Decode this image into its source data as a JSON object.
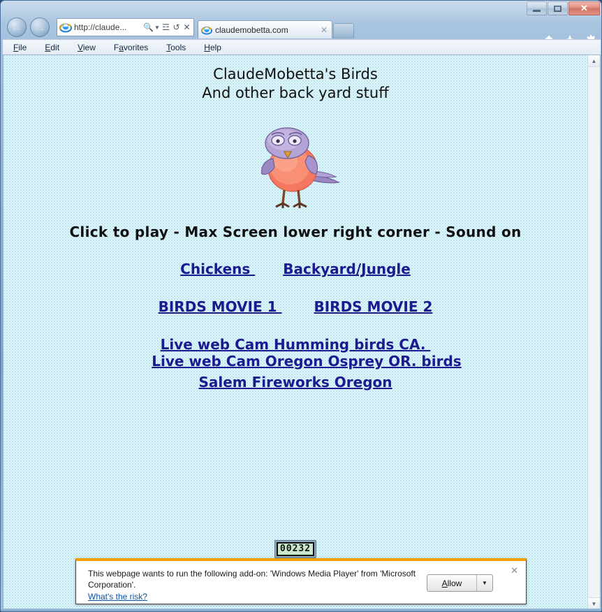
{
  "browser": {
    "window_controls": {
      "minimize": "minimize-icon",
      "maximize": "maximize-icon",
      "close": "✕"
    },
    "nav": {
      "back": "←",
      "forward": "→"
    },
    "address": {
      "value": "http://claude...",
      "search_icon": "🔍",
      "dropdown_caret": "▼",
      "compat_icon": "☲",
      "refresh_icon": "↺",
      "stop_icon": "✕"
    },
    "tab": {
      "title": "claudemobetta.com",
      "close": "✕"
    },
    "toolbar_icons": {
      "home": "home-icon",
      "favorites": "favorites-star-icon",
      "tools": "tools-gear-icon"
    },
    "menu": [
      {
        "pre": "",
        "accel": "F",
        "post": "ile"
      },
      {
        "pre": "",
        "accel": "E",
        "post": "dit"
      },
      {
        "pre": "",
        "accel": "V",
        "post": "iew"
      },
      {
        "pre": "F",
        "accel": "a",
        "post": "vorites"
      },
      {
        "pre": "",
        "accel": "T",
        "post": "ools"
      },
      {
        "pre": "",
        "accel": "H",
        "post": "elp"
      }
    ],
    "scrollbar": {
      "up": "▲",
      "down": "▼"
    }
  },
  "page": {
    "heading_line1": "ClaudeMobetta's Birds",
    "heading_line2": "And other back yard stuff",
    "tagline": "Click to play - Max Screen lower right corner - Sound on",
    "bird_image_alt": "cartoon-bird-image",
    "links": {
      "row1": [
        {
          "label": "Chickens "
        },
        {
          "label": "Backyard/Jungle"
        }
      ],
      "row2": [
        {
          "label": "BIRDS MOVIE 1 "
        },
        {
          "label": "BIRDS MOVIE 2"
        }
      ],
      "row3": [
        {
          "label": "Live web Cam Humming birds CA. "
        },
        {
          "label": "Live web Cam Oregon Osprey OR. birds"
        }
      ],
      "row4": [
        {
          "label": "Salem Fireworks Oregon"
        }
      ]
    },
    "hit_counter": "00232",
    "colors": {
      "background": "#e6f5fa",
      "link": "#1b1b8f",
      "text": "#111111"
    }
  },
  "notification": {
    "message": "This webpage wants to run the following add-on: 'Windows Media Player' from 'Microsoft Corporation'.",
    "risk_link": "What's the risk?",
    "allow_label": "Allow",
    "allow_accel": "A",
    "dropdown_caret": "▼",
    "close": "✕",
    "accent_color": "#f3a000"
  }
}
